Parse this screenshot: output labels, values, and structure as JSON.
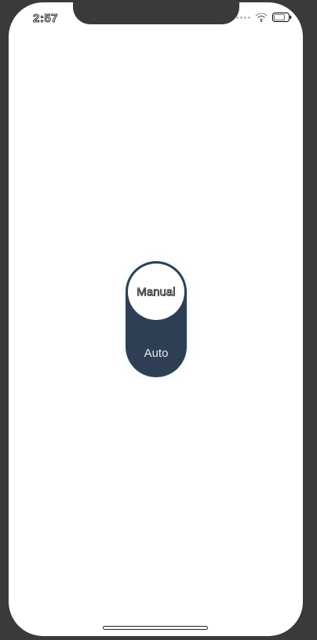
{
  "status_bar": {
    "time": "2:57",
    "icons": [
      "cellular-dots-icon",
      "wifi-icon",
      "battery-icon"
    ]
  },
  "toggle": {
    "selected_label": "Manual",
    "other_label": "Auto",
    "state": "Manual"
  },
  "colors": {
    "track": "#2e3f53",
    "thumb": "#ffffff",
    "device_frame": "#3a3a3a",
    "screen_background": "#ffffff"
  }
}
